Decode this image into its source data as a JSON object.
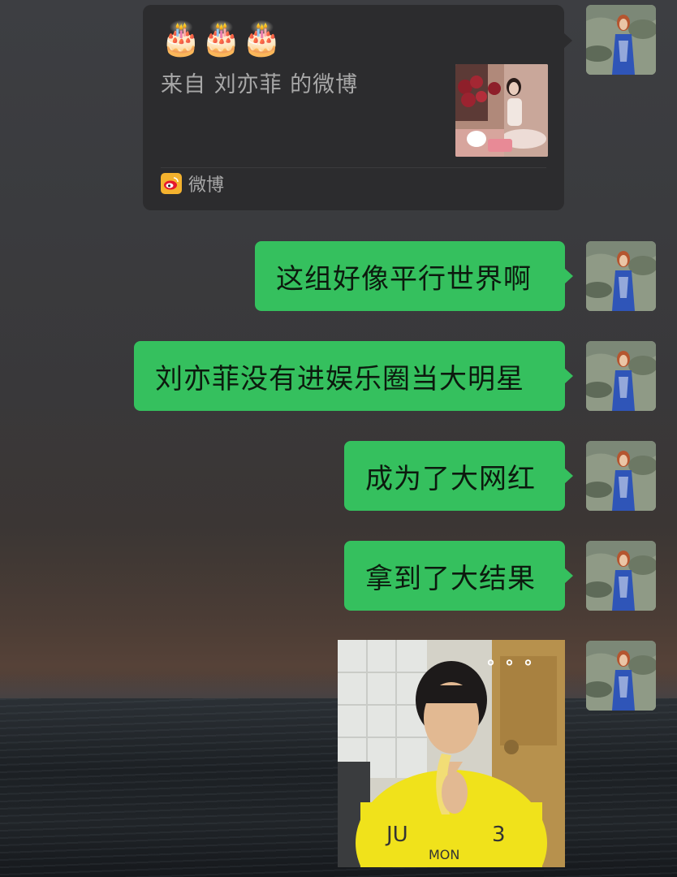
{
  "shared_card": {
    "emoji_line": "🎂🎂🎂",
    "title": "来自 刘亦菲 的微博",
    "source_label": "微博",
    "source_icon": "weibo-icon"
  },
  "messages": [
    {
      "text": "这组好像平行世界啊"
    },
    {
      "text": "刘亦菲没有进娱乐圈当大明星"
    },
    {
      "text": "成为了大网红"
    },
    {
      "text": "拿到了大结果"
    }
  ],
  "image_message": {
    "overlay_dots": "°°°"
  },
  "colors": {
    "bubble_green": "#35c05e",
    "card_bg": "#2c2c2e",
    "card_text": "#a8a8a8"
  }
}
